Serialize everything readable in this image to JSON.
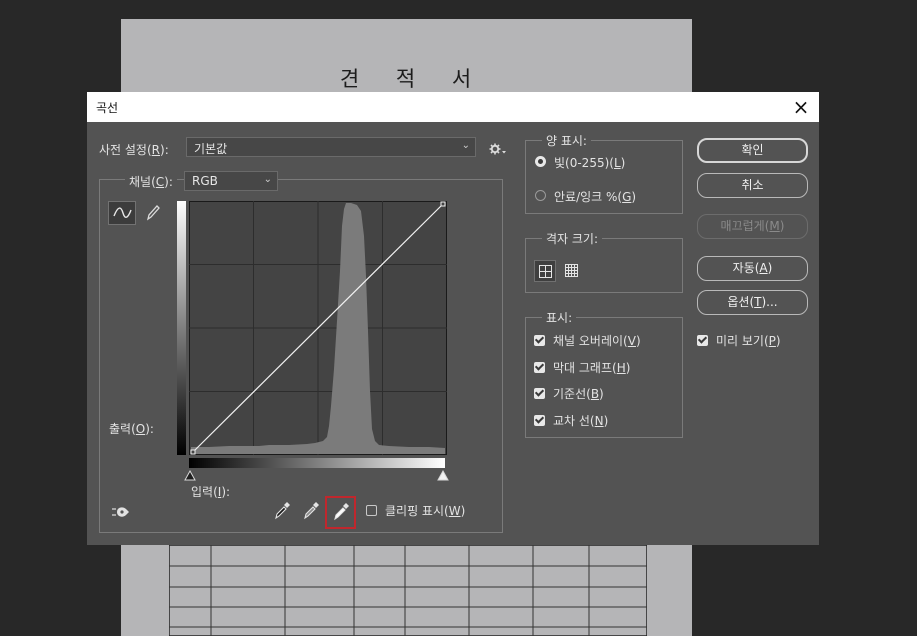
{
  "document": {
    "title": "견 적 서"
  },
  "dialog": {
    "title": "곡선",
    "close_icon": "×",
    "preset_label": "사전 설정(",
    "preset_key": "R",
    "preset_label_end": "):",
    "preset_value": "기본값",
    "channel_label": "채널(",
    "channel_key": "C",
    "channel_label_end": "):",
    "channel_value": "RGB",
    "output_label": "출력(",
    "output_key": "O",
    "output_label_end": "):",
    "input_label": "입력(",
    "input_key": "I",
    "input_label_end": "):",
    "clipping_label": "클리핑 표시(",
    "clipping_key": "W",
    "clipping_label_end": ")",
    "amount": {
      "legend": "양 표시:",
      "light_label": "빛(0-255)(",
      "light_key": "L",
      "light_end": ")",
      "ink_label": "안료/잉크 %(",
      "ink_key": "G",
      "ink_end": ")",
      "selected": "light"
    },
    "grid": {
      "legend": "격자 크기:"
    },
    "show": {
      "legend": "표시:",
      "items": [
        {
          "label": "채널 오버레이(",
          "key": "V",
          "end": ")",
          "checked": true
        },
        {
          "label": "막대 그래프(",
          "key": "H",
          "end": ")",
          "checked": true
        },
        {
          "label": "기준선(",
          "key": "B",
          "end": ")",
          "checked": true
        },
        {
          "label": "교차 선(",
          "key": "N",
          "end": ")",
          "checked": true
        }
      ]
    },
    "buttons": {
      "ok": "확인",
      "cancel": "취소",
      "smooth_label": "매끄럽게(",
      "smooth_key": "M",
      "smooth_end": ")",
      "auto_label": "자동(",
      "auto_key": "A",
      "auto_end": ")",
      "options_label": "옵션(",
      "options_key": "T",
      "options_end": ")..."
    },
    "preview": {
      "label": "미리 보기(",
      "key": "P",
      "end": ")",
      "checked": true
    },
    "colors": {
      "accent_highlight": "#c0272d"
    }
  }
}
